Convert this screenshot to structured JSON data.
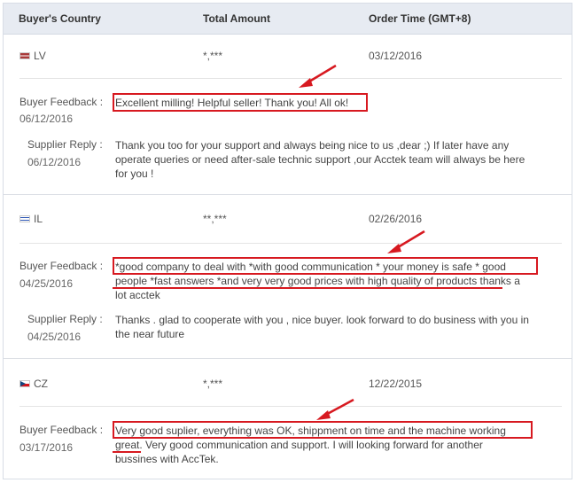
{
  "header": {
    "country": "Buyer's Country",
    "amount": "Total Amount",
    "time": "Order Time (GMT+8)"
  },
  "labels": {
    "feedback": "Buyer Feedback :",
    "reply": "Supplier Reply :"
  },
  "orders": [
    {
      "country": "LV",
      "flag": "latvia-flag-icon",
      "amount": "*,***",
      "order_time": "03/12/2016",
      "feedback_date": "06/12/2016",
      "feedback_lines": [
        "Excellent milling! Helpful seller! Thank you! All ok!"
      ],
      "reply_date": "06/12/2016",
      "reply_lines": [
        "Thank you too for your support and always being nice to us ,dear ;) If later have any",
        "operate queries or need after-sale technic support ,our Acctek team will always be here",
        "for you !"
      ]
    },
    {
      "country": "IL",
      "flag": "israel-flag-icon",
      "amount": "**,***",
      "order_time": "02/26/2016",
      "feedback_date": "04/25/2016",
      "feedback_lines": [
        "*good company to deal with *with good communication * your money is safe * good",
        "people *fast answers *and very very good prices with high quality of products thanks a",
        "lot acctek"
      ],
      "reply_date": "04/25/2016",
      "reply_lines": [
        "Thanks . glad to cooperate with you , nice buyer. look forward to do business with you in",
        "the near future"
      ]
    },
    {
      "country": "CZ",
      "flag": "czech-flag-icon",
      "amount": "*,***",
      "order_time": "12/22/2015",
      "feedback_date": "03/17/2016",
      "feedback_lines": [
        "Very good suplier, everything was OK, shippment on time and the machine working",
        "great. Very good communication and support. I will looking forward for another",
        "bussines with AccTek."
      ]
    }
  ],
  "colors": {
    "header_bg": "#e7ebf2",
    "highlight": "#d71920"
  }
}
